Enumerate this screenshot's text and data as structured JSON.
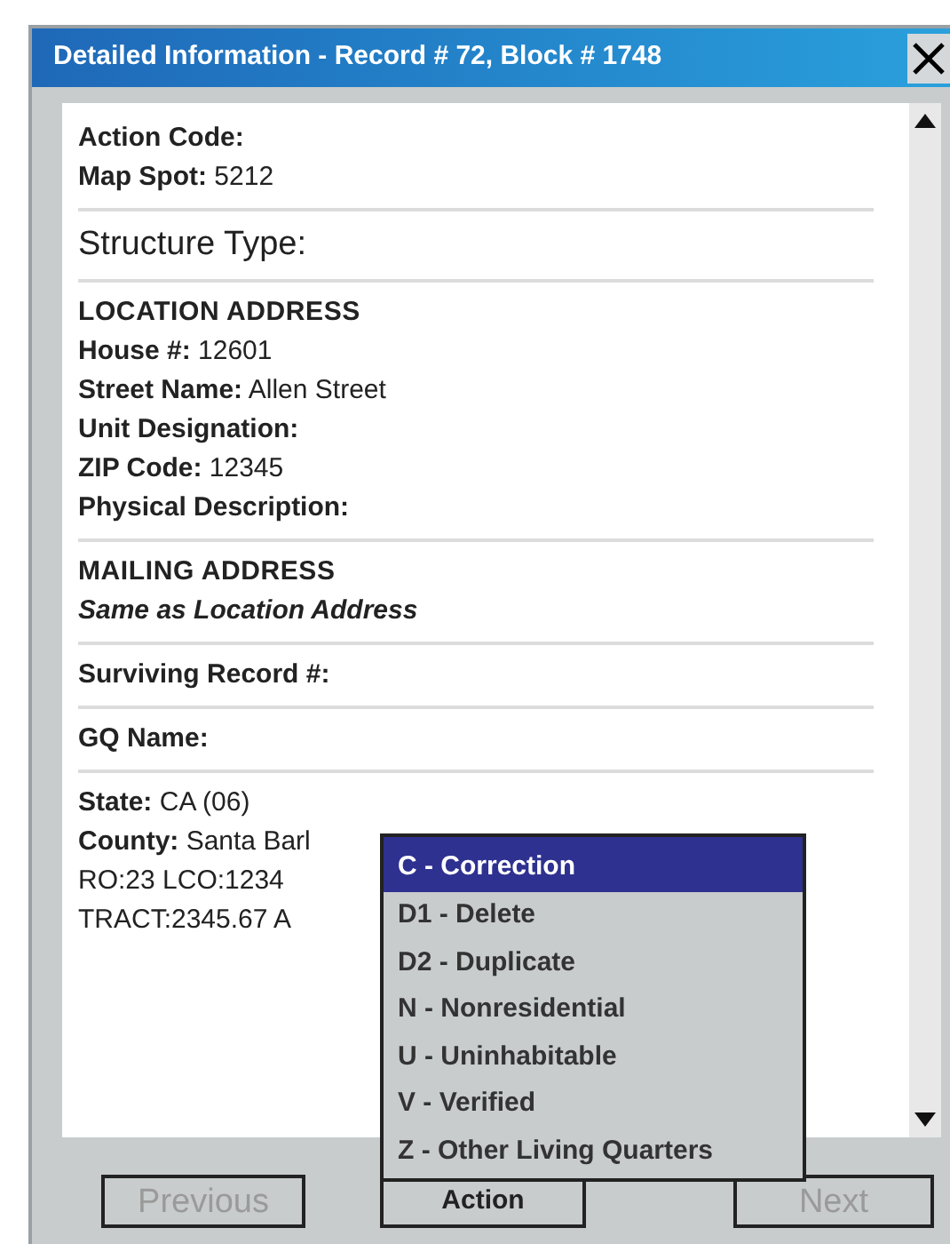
{
  "window": {
    "title": "Detailed Information - Record # 72, Block # 1748"
  },
  "sections": [
    {
      "lines": [
        {
          "kind": "field",
          "text": "**Action Code:**"
        },
        {
          "kind": "field",
          "text": "**Map Spot:** 5212"
        }
      ]
    },
    {
      "lines": [
        {
          "kind": "large",
          "text": "Structure Type:"
        }
      ]
    },
    {
      "lines": [
        {
          "kind": "heading",
          "text": "LOCATION ADDRESS"
        },
        {
          "kind": "field",
          "text": "**House #:** 12601"
        },
        {
          "kind": "field",
          "text": "**Street Name:** Allen Street"
        },
        {
          "kind": "field",
          "text": "**Unit Designation:**"
        },
        {
          "kind": "field",
          "text": "**ZIP Code:** 12345"
        },
        {
          "kind": "field",
          "text": "**Physical Description:**"
        }
      ]
    },
    {
      "lines": [
        {
          "kind": "heading",
          "text": "MAILING ADDRESS"
        },
        {
          "kind": "note",
          "text": "Same as Location Address"
        }
      ]
    },
    {
      "lines": [
        {
          "kind": "field",
          "text": "**Surviving Record #:**"
        }
      ]
    },
    {
      "lines": [
        {
          "kind": "field",
          "text": "**GQ Name:**"
        }
      ]
    },
    {
      "lines": [
        {
          "kind": "field",
          "text": "**State:** CA (06)"
        },
        {
          "kind": "field",
          "text": "**County:** Santa Barl"
        },
        {
          "kind": "plain",
          "text": "RO:23  LCO:1234"
        },
        {
          "kind": "plain",
          "text": "TRACT:2345.67  A"
        }
      ]
    }
  ],
  "menu": [
    {
      "label": "C - Correction",
      "selected": true
    },
    {
      "label": "D1 - Delete",
      "selected": false
    },
    {
      "label": "D2 - Duplicate",
      "selected": false
    },
    {
      "label": "N - Nonresidential",
      "selected": false
    },
    {
      "label": "U - Uninhabitable",
      "selected": false
    },
    {
      "label": "V - Verified",
      "selected": false
    },
    {
      "label": "Z - Other Living Quarters",
      "selected": false
    }
  ],
  "buttons": [
    {
      "label": "Previous",
      "disabled": true
    },
    {
      "label": "Action",
      "disabled": false
    },
    {
      "label": "Next",
      "disabled": true
    }
  ]
}
